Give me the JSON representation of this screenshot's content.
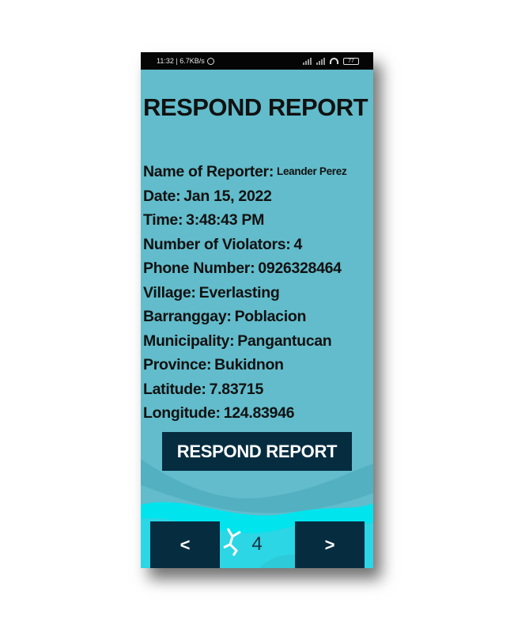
{
  "status_bar": {
    "time_speed": "11:32 | 6.7KB/s",
    "battery": "77"
  },
  "screen": {
    "title": "RESPOND REPORT"
  },
  "report": {
    "reporter_label": "Name of Reporter:",
    "reporter_value": "Leander Perez",
    "date_label": "Date:",
    "date_value": "Jan 15, 2022",
    "time_label": "Time:",
    "time_value": "3:48:43 PM",
    "violators_label": "Number of Violators:",
    "violators_value": "4",
    "phone_label": "Phone Number:",
    "phone_value": "0926328464",
    "village_label": "Village:",
    "village_value": "Everlasting",
    "barangay_label": "Barranggay:",
    "barangay_value": "Poblacion",
    "municipality_label": "Municipality:",
    "municipality_value": "Pangantucan",
    "province_label": "Province:",
    "province_value": "Bukidnon",
    "latitude_label": "Latitude:",
    "latitude_value": "7.83715",
    "longitude_label": "Longitude:",
    "longitude_value": "124.83946"
  },
  "actions": {
    "respond_label": "RESPOND REPORT"
  },
  "pagination": {
    "prev_label": "<",
    "page": "4",
    "next_label": ">"
  },
  "colors": {
    "card_bg": "#62bccb",
    "button_bg": "#062c40",
    "wave_aqua": "#00e4ee"
  },
  "icons": [
    "alarm-icon",
    "signal-icon",
    "wifi-icon",
    "battery-icon"
  ]
}
